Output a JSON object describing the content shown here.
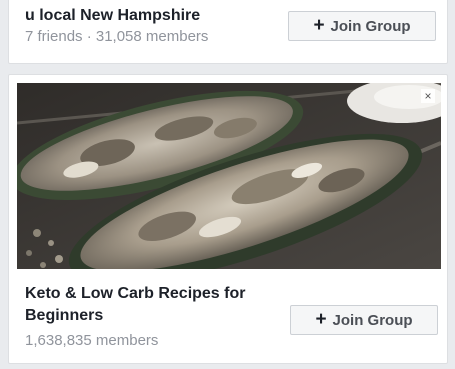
{
  "groups": [
    {
      "title": "u local New Hampshire",
      "meta": "7 friends · 31,058 members",
      "button_label": "Join Group"
    },
    {
      "title": "Keto & Low Carb Recipes for Beginners",
      "meta": "1,638,835 members",
      "button_label": "Join Group",
      "image_alt": "stuffed zucchini boats food photo",
      "close_glyph": "×"
    }
  ],
  "icons": {
    "plus": "+"
  }
}
